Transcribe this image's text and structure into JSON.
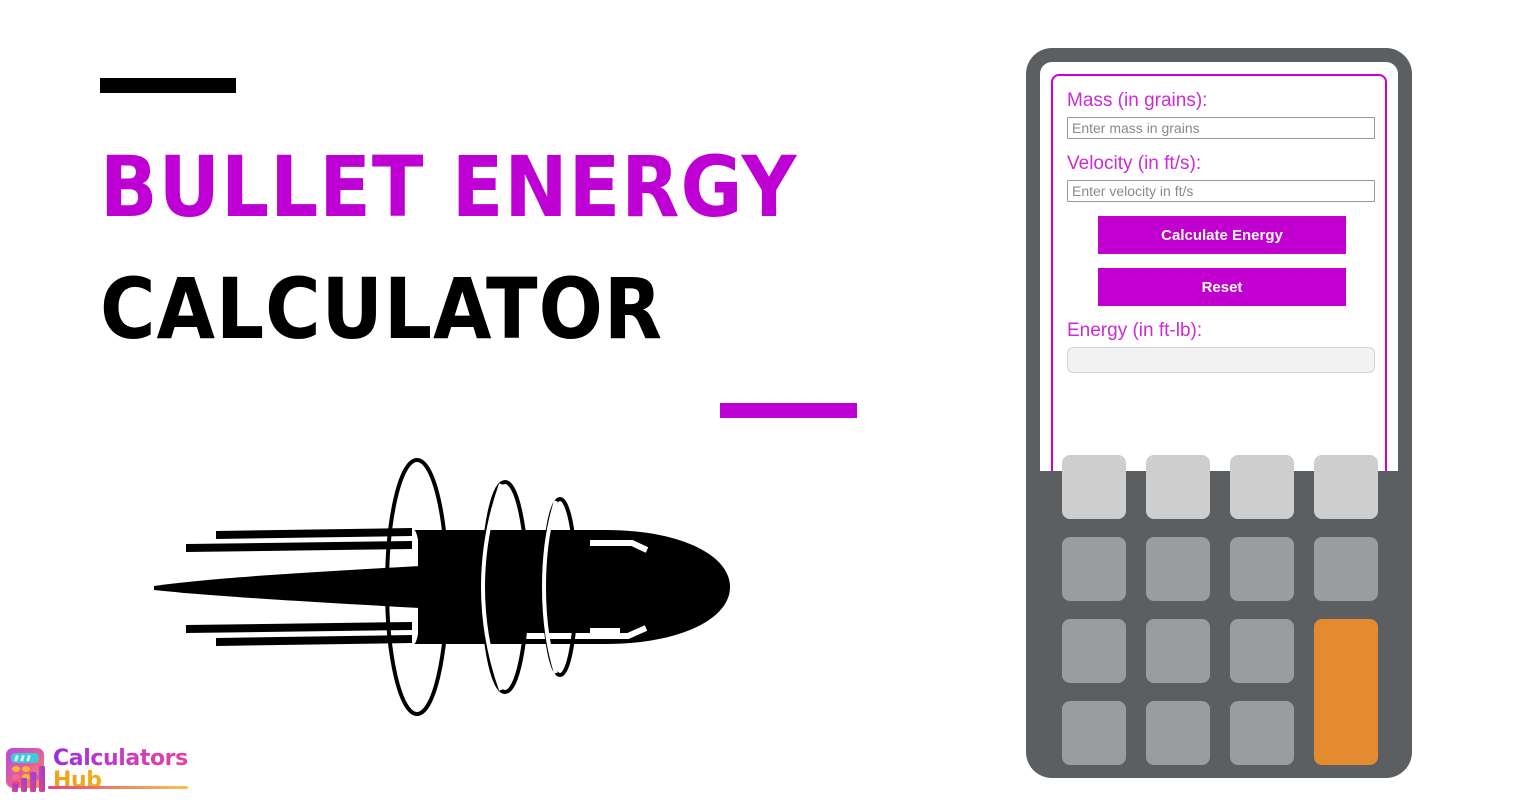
{
  "hero": {
    "title_line_1": "BULLET ENERGY",
    "title_line_2": "CALCULATOR",
    "top_rule_color": "#000000",
    "bottom_rule_color": "#BE00D4",
    "accent_color": "#BE00D4",
    "illustration_name": "bullet-in-flight-silhouette"
  },
  "brand": {
    "word_1": "Calculators",
    "word_2": "Hub",
    "mark_name": "calculator-bar-chart-logo-icon",
    "gradient_start": "#9A2CE0",
    "gradient_end": "#F5C518"
  },
  "calculator": {
    "device_color": "#5C5F61",
    "screen_background": "#ffffff",
    "panel_border_color": "#CC00D6",
    "form": {
      "mass": {
        "label": "Mass (in grains):",
        "placeholder": "Enter mass in grains",
        "value": ""
      },
      "velocity": {
        "label": "Velocity (in ft/s):",
        "placeholder": "Enter velocity in ft/s",
        "value": ""
      },
      "energy": {
        "label": "Energy (in ft-lb):",
        "placeholder": "",
        "value": ""
      },
      "buttons": {
        "calculate_label": "Calculate Energy",
        "reset_label": "Reset",
        "button_color": "#C100CF",
        "button_text_color": "#ffffff"
      }
    },
    "keypad": {
      "rows": 4,
      "columns": 4,
      "keys": [
        {
          "name": "key-r1c1",
          "style": "light",
          "label": ""
        },
        {
          "name": "key-r1c2",
          "style": "light",
          "label": ""
        },
        {
          "name": "key-r1c3",
          "style": "light",
          "label": ""
        },
        {
          "name": "key-r1c4",
          "style": "light",
          "label": ""
        },
        {
          "name": "key-r2c1",
          "style": "mid",
          "label": ""
        },
        {
          "name": "key-r2c2",
          "style": "mid",
          "label": ""
        },
        {
          "name": "key-r2c3",
          "style": "mid",
          "label": ""
        },
        {
          "name": "key-r2c4",
          "style": "mid",
          "label": ""
        },
        {
          "name": "key-r3c1",
          "style": "mid",
          "label": ""
        },
        {
          "name": "key-r3c2",
          "style": "mid",
          "label": ""
        },
        {
          "name": "key-r3c3",
          "style": "mid",
          "label": ""
        },
        {
          "name": "key-accent-equals",
          "style": "accent",
          "label": ""
        },
        {
          "name": "key-r4c1",
          "style": "mid",
          "label": ""
        },
        {
          "name": "key-r4c2",
          "style": "mid",
          "label": ""
        },
        {
          "name": "key-r4c3",
          "style": "mid",
          "label": ""
        }
      ],
      "light_key_color": "#CECECE",
      "mid_key_color": "#9A9C9E",
      "accent_key_color": "#E38B2E"
    }
  }
}
